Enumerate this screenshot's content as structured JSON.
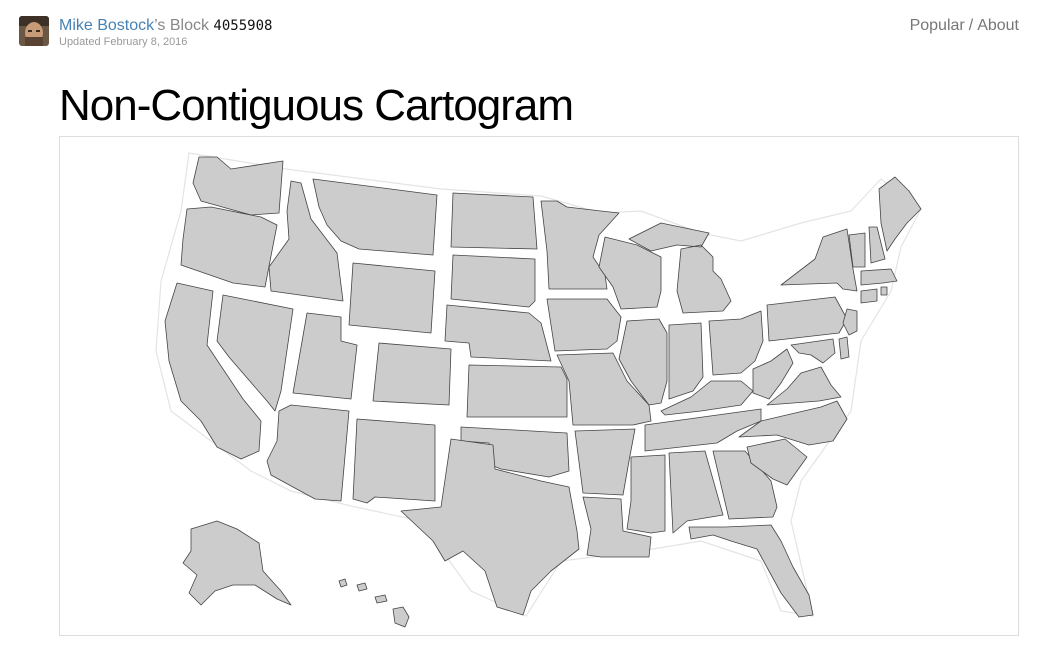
{
  "header": {
    "user_name": "Mike Bostock",
    "user_suffix": "’s Block ",
    "gist_id": "4055908",
    "updated": "Updated February 8, 2016"
  },
  "nav": {
    "popular": "Popular",
    "separator": "/",
    "about": "About"
  },
  "page": {
    "title": "Non-Contiguous Cartogram"
  },
  "map": {
    "fill_color": "#cccccc",
    "stroke_color": "#444444",
    "states": [
      "Washington",
      "Oregon",
      "California",
      "Idaho",
      "Nevada",
      "Montana",
      "Wyoming",
      "Utah",
      "Arizona",
      "Colorado",
      "New Mexico",
      "North Dakota",
      "South Dakota",
      "Nebraska",
      "Kansas",
      "Oklahoma",
      "Texas",
      "Minnesota",
      "Iowa",
      "Missouri",
      "Arkansas",
      "Louisiana",
      "Wisconsin",
      "Illinois",
      "Michigan",
      "Indiana",
      "Ohio",
      "Kentucky",
      "Tennessee",
      "Mississippi",
      "Alabama",
      "Georgia",
      "Florida",
      "South Carolina",
      "North Carolina",
      "Virginia",
      "West Virginia",
      "Pennsylvania",
      "New York",
      "Maryland",
      "Delaware",
      "New Jersey",
      "Connecticut",
      "Rhode Island",
      "Massachusetts",
      "Vermont",
      "New Hampshire",
      "Maine",
      "Alaska",
      "Hawaii"
    ]
  }
}
